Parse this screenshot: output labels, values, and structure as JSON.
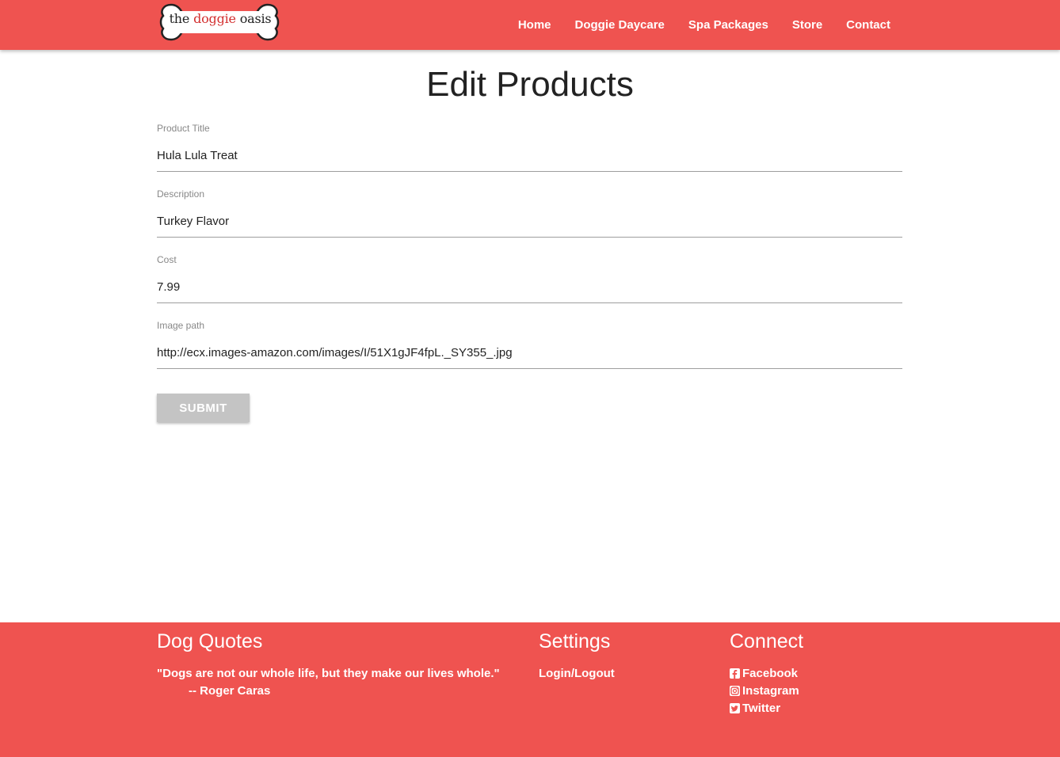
{
  "header": {
    "logo": {
      "prefix": "the",
      "highlight": "doggie",
      "suffix": "oasis"
    },
    "nav": [
      {
        "label": "Home"
      },
      {
        "label": "Doggie Daycare"
      },
      {
        "label": "Spa Packages"
      },
      {
        "label": "Store"
      },
      {
        "label": "Contact"
      }
    ]
  },
  "main": {
    "title": "Edit Products",
    "fields": [
      {
        "label": "Product Title",
        "value": "Hula Lula Treat"
      },
      {
        "label": "Description",
        "value": "Turkey Flavor"
      },
      {
        "label": "Cost",
        "value": "7.99"
      },
      {
        "label": "Image path",
        "value": "http://ecx.images-amazon.com/images/I/51X1gJF4fpL._SY355_.jpg"
      }
    ],
    "submit_label": "SUBMIT"
  },
  "footer": {
    "quotes": {
      "heading": "Dog Quotes",
      "quote": "\"Dogs are not our whole life, but they make our lives whole.\"",
      "author": "-- Roger Caras"
    },
    "settings": {
      "heading": "Settings",
      "link": "Login/Logout"
    },
    "connect": {
      "heading": "Connect",
      "links": [
        {
          "label": "Facebook",
          "icon": "facebook-icon"
        },
        {
          "label": "Instagram",
          "icon": "instagram-icon"
        },
        {
          "label": "Twitter",
          "icon": "twitter-icon"
        }
      ]
    }
  },
  "colors": {
    "brand": "#ef5350",
    "button_disabled": "#c4c4c4"
  }
}
